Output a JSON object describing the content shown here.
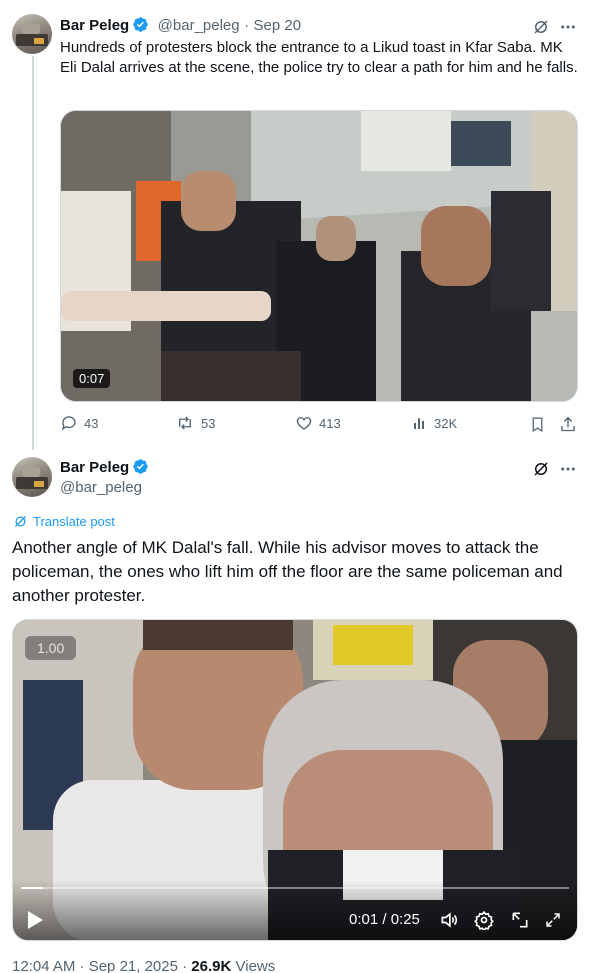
{
  "tweet1": {
    "author_name": "Bar Peleg",
    "handle": "@bar_peleg",
    "separator": "·",
    "date": "Sep 20",
    "text": "Hundreds of protesters block the entrance to a Likud toast in Kfar Saba. MK Eli Dalal arrives at the scene, the police try to clear a path for him and he falls.",
    "video_duration": "0:07",
    "replies": "43",
    "reposts": "53",
    "likes": "413",
    "views": "32K"
  },
  "tweet2": {
    "author_name": "Bar Peleg",
    "handle": "@bar_peleg",
    "translate_label": "Translate post",
    "text": "Another angle of MK Dalal's fall. While his advisor moves to attack the policeman, the ones who lift him off the floor are the same policeman and another protester.",
    "playback_rate": "1.00",
    "video_time": "0:01 / 0:25",
    "progress_fraction": 0.04,
    "timestamp": "12:04 AM · Sep 21, 2025 · ",
    "view_count": "26.9K",
    "views_label": "Views"
  },
  "colors": {
    "accent": "#1d9bf0",
    "muted_text": "#536471",
    "primary_text": "#0f1419",
    "divider": "#cfd9de"
  },
  "icons": {
    "grok": "grok-icon",
    "more": "more-icon",
    "reply": "reply-icon",
    "repost": "repost-icon",
    "like": "like-icon",
    "views": "views-icon",
    "bookmark": "bookmark-icon",
    "share": "share-icon",
    "verified": "verified-badge-icon",
    "play": "play-icon",
    "volume": "volume-icon",
    "settings": "settings-icon",
    "pip": "picture-in-picture-icon",
    "fullscreen": "fullscreen-icon",
    "translate": "translate-icon"
  }
}
